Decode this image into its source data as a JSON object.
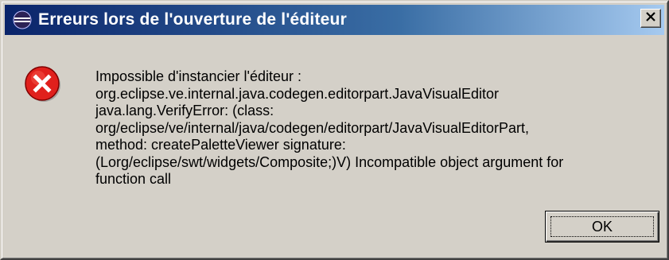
{
  "window": {
    "title": "Erreurs lors de l'ouverture de l'éditeur",
    "app_icon": "eclipse-icon",
    "close_icon": "close-x-icon"
  },
  "dialog": {
    "status_icon": "error-icon",
    "message_lines": [
      "Impossible d'instancier l'éditeur :",
      "org.eclipse.ve.internal.java.codegen.editorpart.JavaVisualEditor",
      "java.lang.VerifyError: (class:",
      "org/eclipse/ve/internal/java/codegen/editorpart/JavaVisualEditorPart,",
      "method: createPaletteViewer signature:",
      "(Lorg/eclipse/swt/widgets/Composite;)V) Incompatible object argument for",
      "function call"
    ],
    "ok_label": "OK"
  },
  "colors": {
    "face": "#d4d0c8",
    "title_gradient_start": "#0a246a",
    "title_gradient_end": "#a6caf0",
    "error_red": "#e0201c"
  }
}
